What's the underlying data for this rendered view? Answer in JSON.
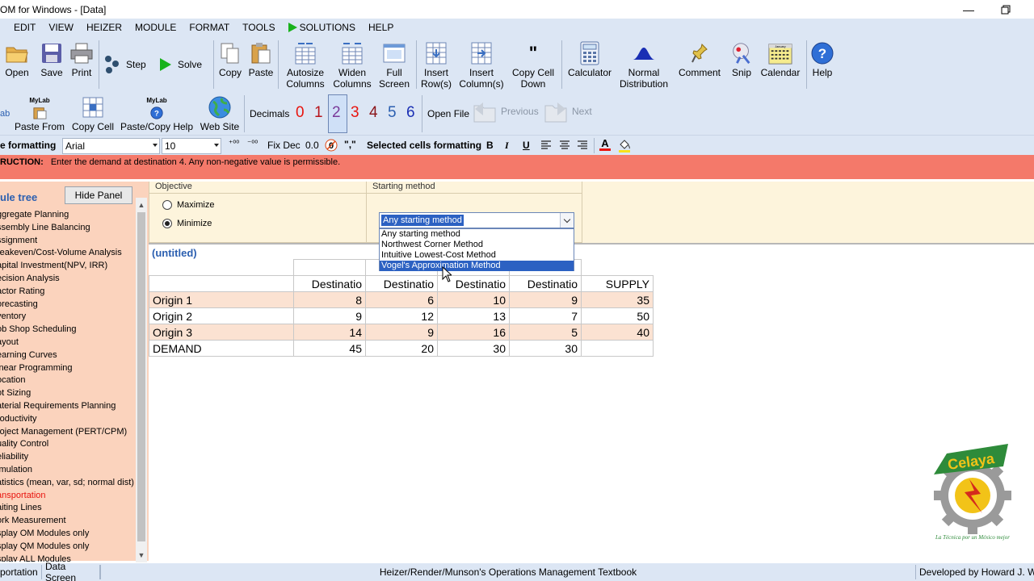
{
  "window": {
    "title": "OM for Windows - [Data]"
  },
  "menu": [
    "EDIT",
    "VIEW",
    "HEIZER",
    "MODULE",
    "FORMAT",
    "TOOLS",
    "SOLUTIONS",
    "HELP"
  ],
  "toolbar1": {
    "open": "Open",
    "save": "Save",
    "print": "Print",
    "step": "Step",
    "solve": "Solve",
    "copy": "Copy",
    "paste": "Paste",
    "autosize_1": "Autosize",
    "autosize_2": "Columns",
    "widen_1": "Widen",
    "widen_2": "Columns",
    "full_1": "Full",
    "full_2": "Screen",
    "insrow_1": "Insert",
    "insrow_2": "Row(s)",
    "inscol_1": "Insert",
    "inscol_2": "Column(s)",
    "copydown_1": "Copy Cell",
    "copydown_2": "Down",
    "calculator": "Calculator",
    "normal_1": "Normal",
    "normal_2": "Distribution",
    "comment": "Comment",
    "snip": "Snip",
    "calendar": "Calendar",
    "help": "Help"
  },
  "toolbar2": {
    "lab": "ab",
    "mylab": "MyLab",
    "paste_from": "Paste From",
    "copy_cell": "Copy Cell",
    "paste_copy_help": "Paste/Copy Help",
    "web_site": "Web Site",
    "decimals": "Decimals",
    "digits": [
      "0",
      "1",
      "2",
      "3",
      "4",
      "5",
      "6"
    ],
    "open_file": "Open File",
    "previous": "Previous",
    "next": "Next",
    "calendar_tag": "January"
  },
  "format_bar": {
    "label": "e formatting",
    "font": "Arial",
    "size": "10",
    "fix_dec": "Fix Dec",
    "fix_val": "0.0",
    "comma": "\",\"",
    "selected": "Selected cells formatting",
    "bold": "B",
    "italic": "I",
    "underline": "U",
    "fontcolor": "A"
  },
  "instruction": {
    "label": "RUCTION:",
    "text": "Enter the demand at destination 4. Any non-negative value is permissible."
  },
  "panel": {
    "title": "ule tree",
    "hide_button": "Hide Panel",
    "items": [
      "ggregate Planning",
      "ssembly Line Balancing",
      "ssignment",
      "reakeven/Cost-Volume Analysis",
      "apital Investment(NPV, IRR)",
      "ecision Analysis",
      "actor Rating",
      "orecasting",
      "ventory",
      "ob Shop Scheduling",
      "ayout",
      "earning Curves",
      "inear Programming",
      "ocation",
      "ot Sizing",
      "aterial Requirements Planning",
      "roductivity",
      "roject Management (PERT/CPM)",
      "uality Control",
      "eliability",
      "imulation",
      "atistics (mean, var, sd; normal dist)",
      "ansportation",
      "aiting Lines",
      "ork Measurement",
      "splay OM Modules only",
      "splay QM Modules only",
      "splay ALL Modules"
    ],
    "active_index": 22
  },
  "objective": {
    "title": "Objective",
    "maximize": "Maximize",
    "minimize": "Minimize",
    "selected": "Minimize"
  },
  "starting_method": {
    "title": "Starting method",
    "selected": "Any starting method",
    "options": [
      "Any starting method",
      "Northwest Corner Method",
      "Intuitive Lowest-Cost Method",
      "Vogel's Approximation Method"
    ],
    "highlighted_index": 3
  },
  "grid": {
    "title": "(untitled)",
    "headers": [
      "",
      "Destinatio",
      "Destinatio",
      "Destinatio",
      "Destinatio",
      "SUPPLY"
    ],
    "rows": [
      [
        "Origin 1",
        "8",
        "6",
        "10",
        "9",
        "35"
      ],
      [
        "Origin 2",
        "9",
        "12",
        "13",
        "7",
        "50"
      ],
      [
        "Origin 3",
        "14",
        "9",
        "16",
        "5",
        "40"
      ],
      [
        "DEMAND",
        "45",
        "20",
        "30",
        "30",
        ""
      ]
    ]
  },
  "logo": {
    "text": "Celaya",
    "motto": "La Técnica por un México mejor"
  },
  "status": {
    "module": "portation",
    "screen": "Data Screen",
    "book": "Heizer/Render/Munson's Operations Management Textbook",
    "developer": "Developed by Howard J. We"
  }
}
